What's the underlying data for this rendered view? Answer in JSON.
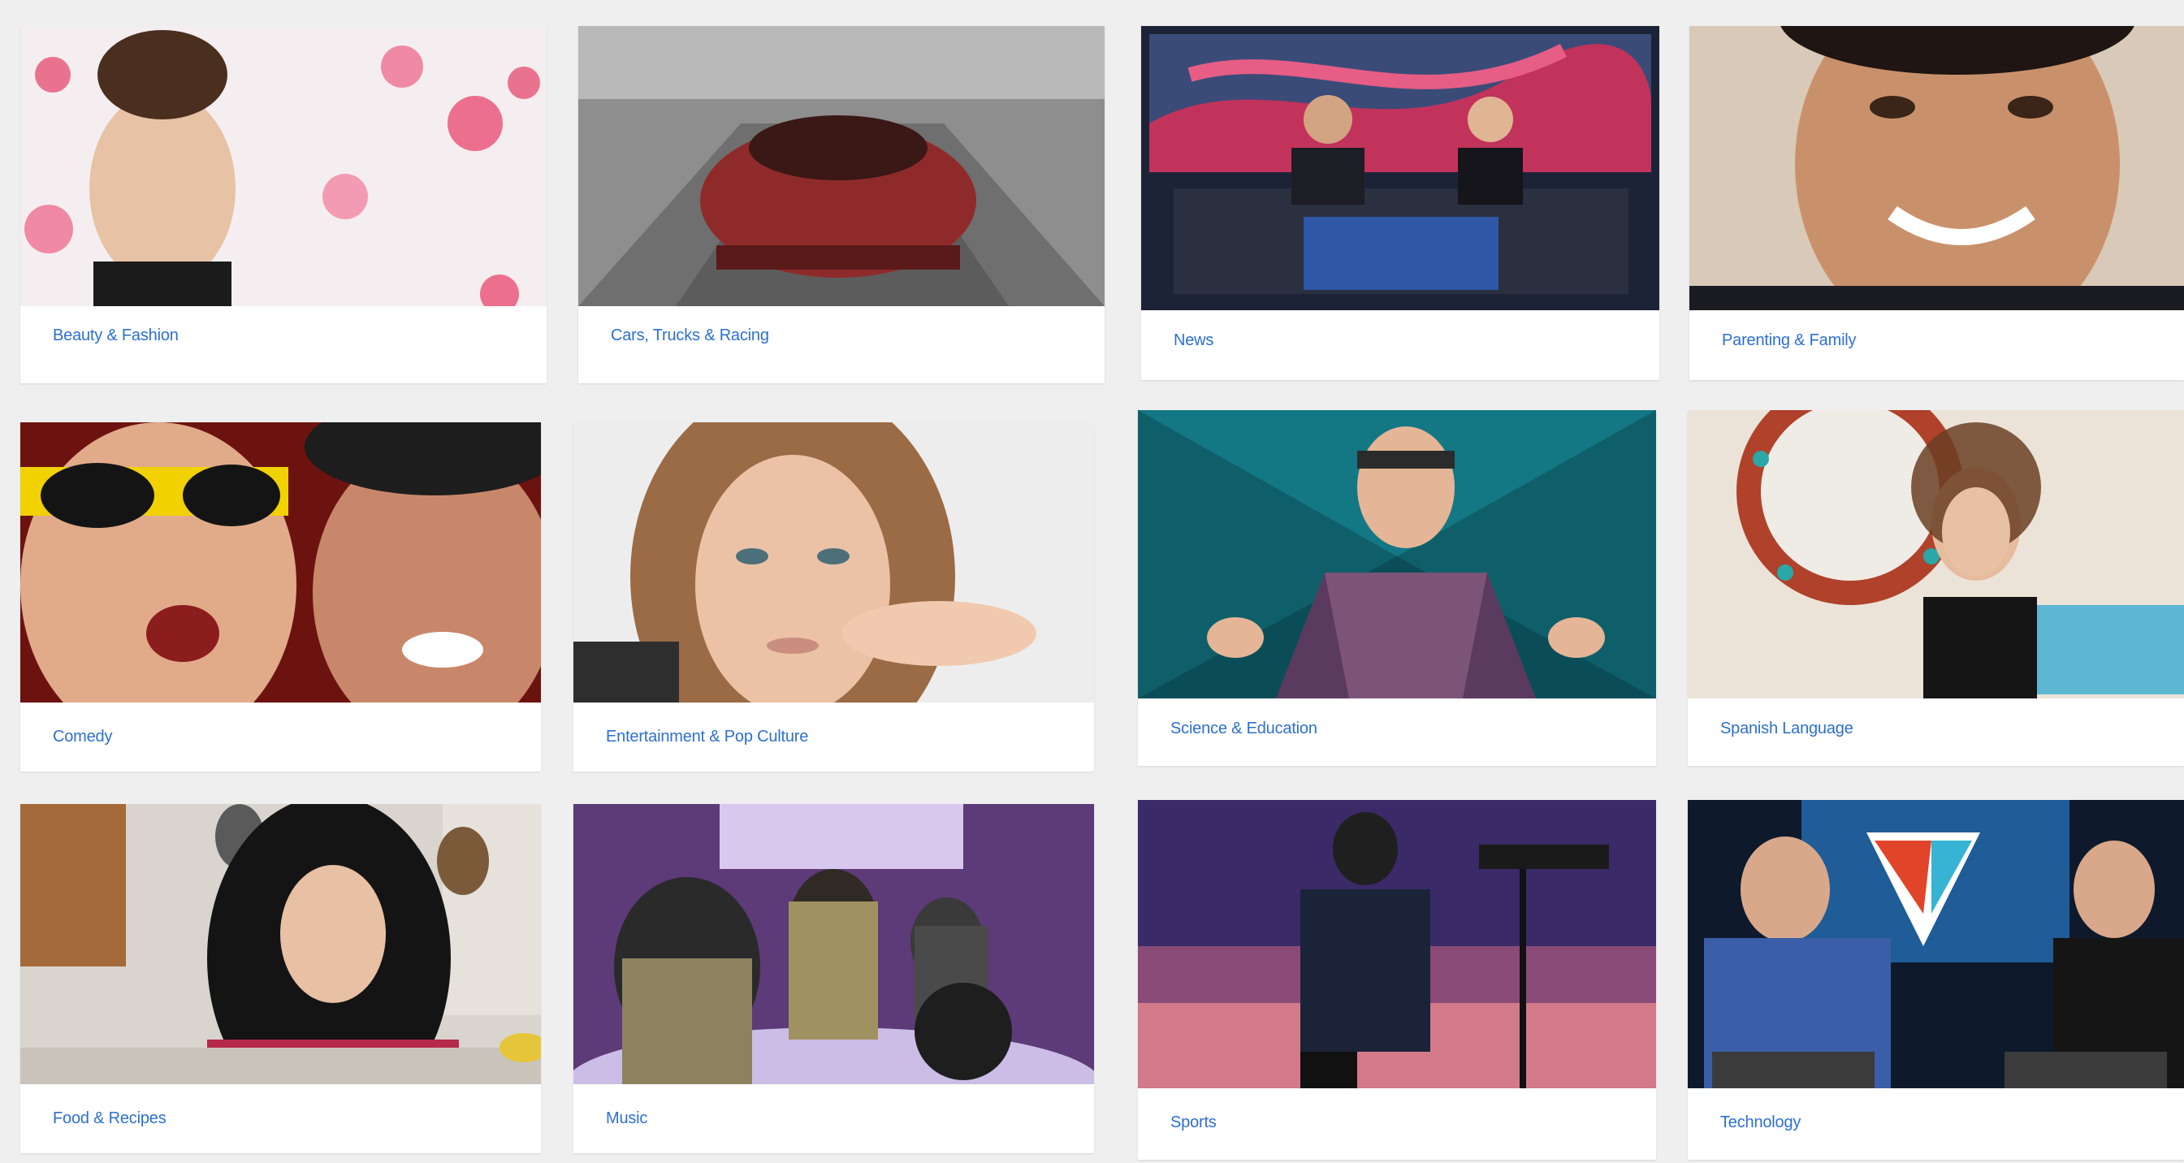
{
  "categories": [
    {
      "label": "Beauty & Fashion"
    },
    {
      "label": "Cars, Trucks & Racing"
    },
    {
      "label": "News"
    },
    {
      "label": "Parenting & Family"
    },
    {
      "label": "Comedy"
    },
    {
      "label": "Entertainment & Pop Culture"
    },
    {
      "label": "Science & Education"
    },
    {
      "label": "Spanish Language"
    },
    {
      "label": "Food & Recipes"
    },
    {
      "label": "Music"
    },
    {
      "label": "Sports"
    },
    {
      "label": "Technology"
    }
  ],
  "colors": {
    "label": "#2d6fd1",
    "page_background": "#efefef",
    "card_background": "#ffffff"
  }
}
